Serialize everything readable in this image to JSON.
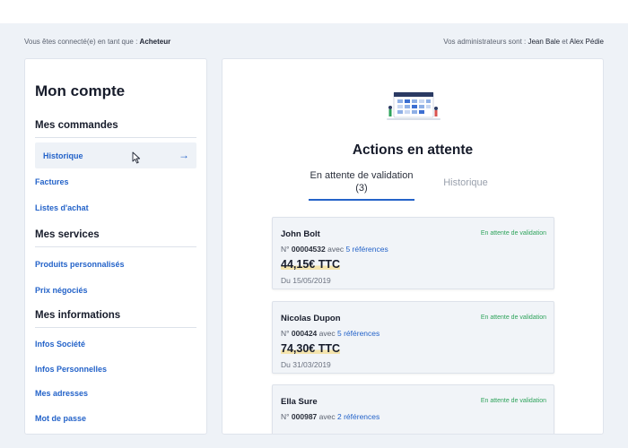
{
  "header": {
    "connected_prefix": "Vous êtes connecté(e) en tant que :",
    "role": "Acheteur",
    "admins_prefix": "Vos administrateurs sont :",
    "admin_1": "Jean Bale",
    "admins_joiner": "et",
    "admin_2": "Alex Pédie"
  },
  "sidebar": {
    "title": "Mon compte",
    "sections": [
      {
        "title": "Mes commandes",
        "items": [
          "Historique",
          "Factures",
          "Listes d'achat"
        ]
      },
      {
        "title": "Mes services",
        "items": [
          "Produits personnalisés",
          "Prix négociés"
        ]
      },
      {
        "title": "Mes informations",
        "items": [
          "Infos Société",
          "Infos Personnelles",
          "Mes adresses",
          "Mot de passe"
        ]
      }
    ]
  },
  "main": {
    "title": "Actions en attente",
    "tabs": [
      {
        "label": "En attente de validation (3)",
        "active": true
      },
      {
        "label": "Historique",
        "active": false
      }
    ],
    "orders": [
      {
        "name": "John Bolt",
        "status": "En attente de validation",
        "no_prefix": "N°",
        "number": "00004532",
        "with": "avec",
        "refs": "5 références",
        "price": "44,15€ TTC",
        "date": "Du 15/05/2019"
      },
      {
        "name": "Nicolas Dupon",
        "status": "En attente de validation",
        "no_prefix": "N°",
        "number": "000424",
        "with": "avec",
        "refs": "5 références",
        "price": "74,30€ TTC",
        "date": "Du 31/03/2019"
      },
      {
        "name": "Ella Sure",
        "status": "En attente de validation",
        "no_prefix": "N°",
        "number": "000987",
        "with": "avec",
        "refs": "2 références",
        "price": "",
        "date": ""
      }
    ]
  },
  "colors": {
    "accent": "#2463c9",
    "status_green": "#2ea35b",
    "price_highlight": "#f4e4ad",
    "background": "#eef2f7"
  },
  "icons": {
    "active_item_arrow": "arrow-right-icon",
    "cursor": "mouse-cursor-icon",
    "illustration": "calendar-illustration"
  }
}
